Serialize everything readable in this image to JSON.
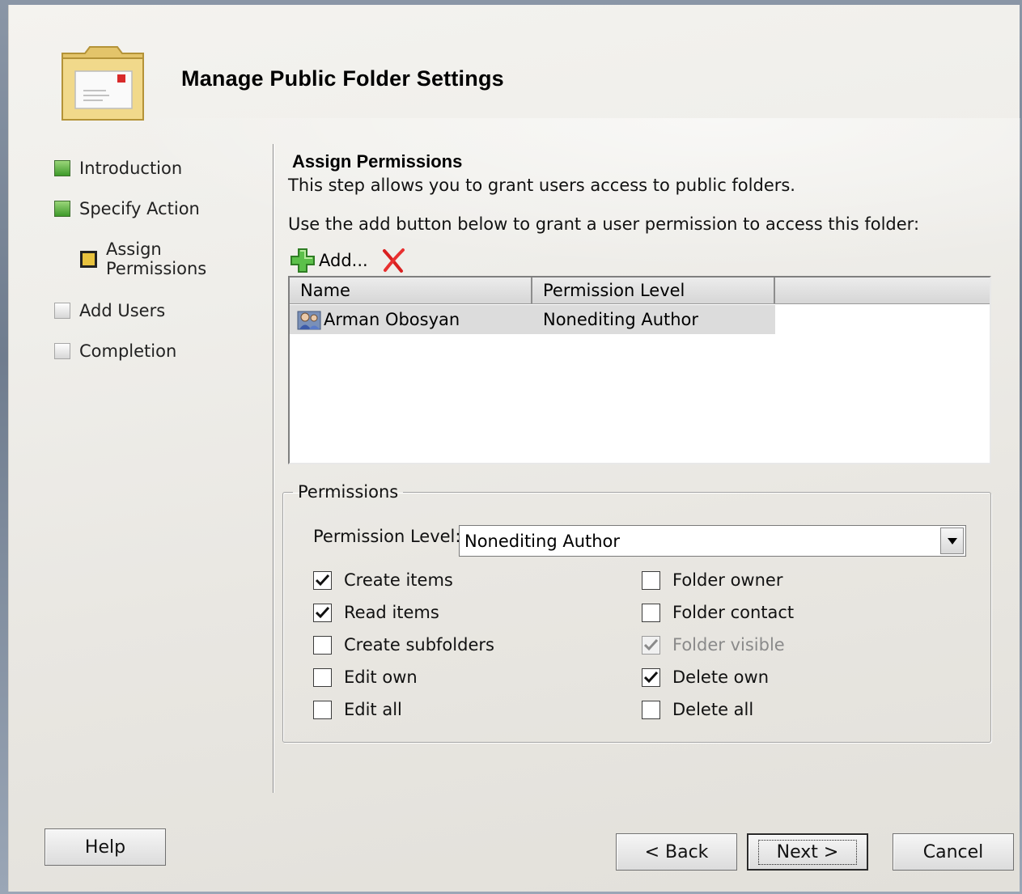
{
  "window": {
    "title": "Manage Public Folder Settings"
  },
  "nav": {
    "items": [
      {
        "label": "Introduction",
        "state": "done"
      },
      {
        "label": "Specify Action",
        "state": "done"
      },
      {
        "label": "Assign Permissions",
        "state": "current"
      },
      {
        "label": "Add Users",
        "state": "todo"
      },
      {
        "label": "Completion",
        "state": "todo"
      }
    ]
  },
  "main": {
    "section_title": "Assign Permissions",
    "description": "This step allows you to grant users access to public folders.",
    "instruction": "Use the add button below to grant a user permission to access this folder:",
    "toolbar": {
      "add_label": "Add...",
      "add_icon": "green-plus-icon",
      "delete_icon": "red-x-icon"
    },
    "list": {
      "columns": [
        "Name",
        "Permission Level"
      ],
      "rows": [
        {
          "name": "Arman Obosyan",
          "permission_level": "Nonediting Author",
          "icon": "user-icon"
        }
      ]
    },
    "permissions": {
      "group_label": "Permissions",
      "level_label": "Permission Level:",
      "level_value": "Nonediting Author",
      "checkboxes": [
        {
          "label": "Create items",
          "checked": true,
          "disabled": false
        },
        {
          "label": "Read items",
          "checked": true,
          "disabled": false
        },
        {
          "label": "Create subfolders",
          "checked": false,
          "disabled": false
        },
        {
          "label": "Edit own",
          "checked": false,
          "disabled": false
        },
        {
          "label": "Edit all",
          "checked": false,
          "disabled": false
        },
        {
          "label": "Folder owner",
          "checked": false,
          "disabled": false
        },
        {
          "label": "Folder contact",
          "checked": false,
          "disabled": false
        },
        {
          "label": "Folder visible",
          "checked": true,
          "disabled": true
        },
        {
          "label": "Delete own",
          "checked": true,
          "disabled": false
        },
        {
          "label": "Delete all",
          "checked": false,
          "disabled": false
        }
      ]
    }
  },
  "footer": {
    "help_label": "Help",
    "back_label": "< Back",
    "next_label": "Next >",
    "cancel_label": "Cancel"
  },
  "colors": {
    "done": "#4fa83a",
    "current": "#e8c23e",
    "selected_row": "#dcdcdc"
  }
}
